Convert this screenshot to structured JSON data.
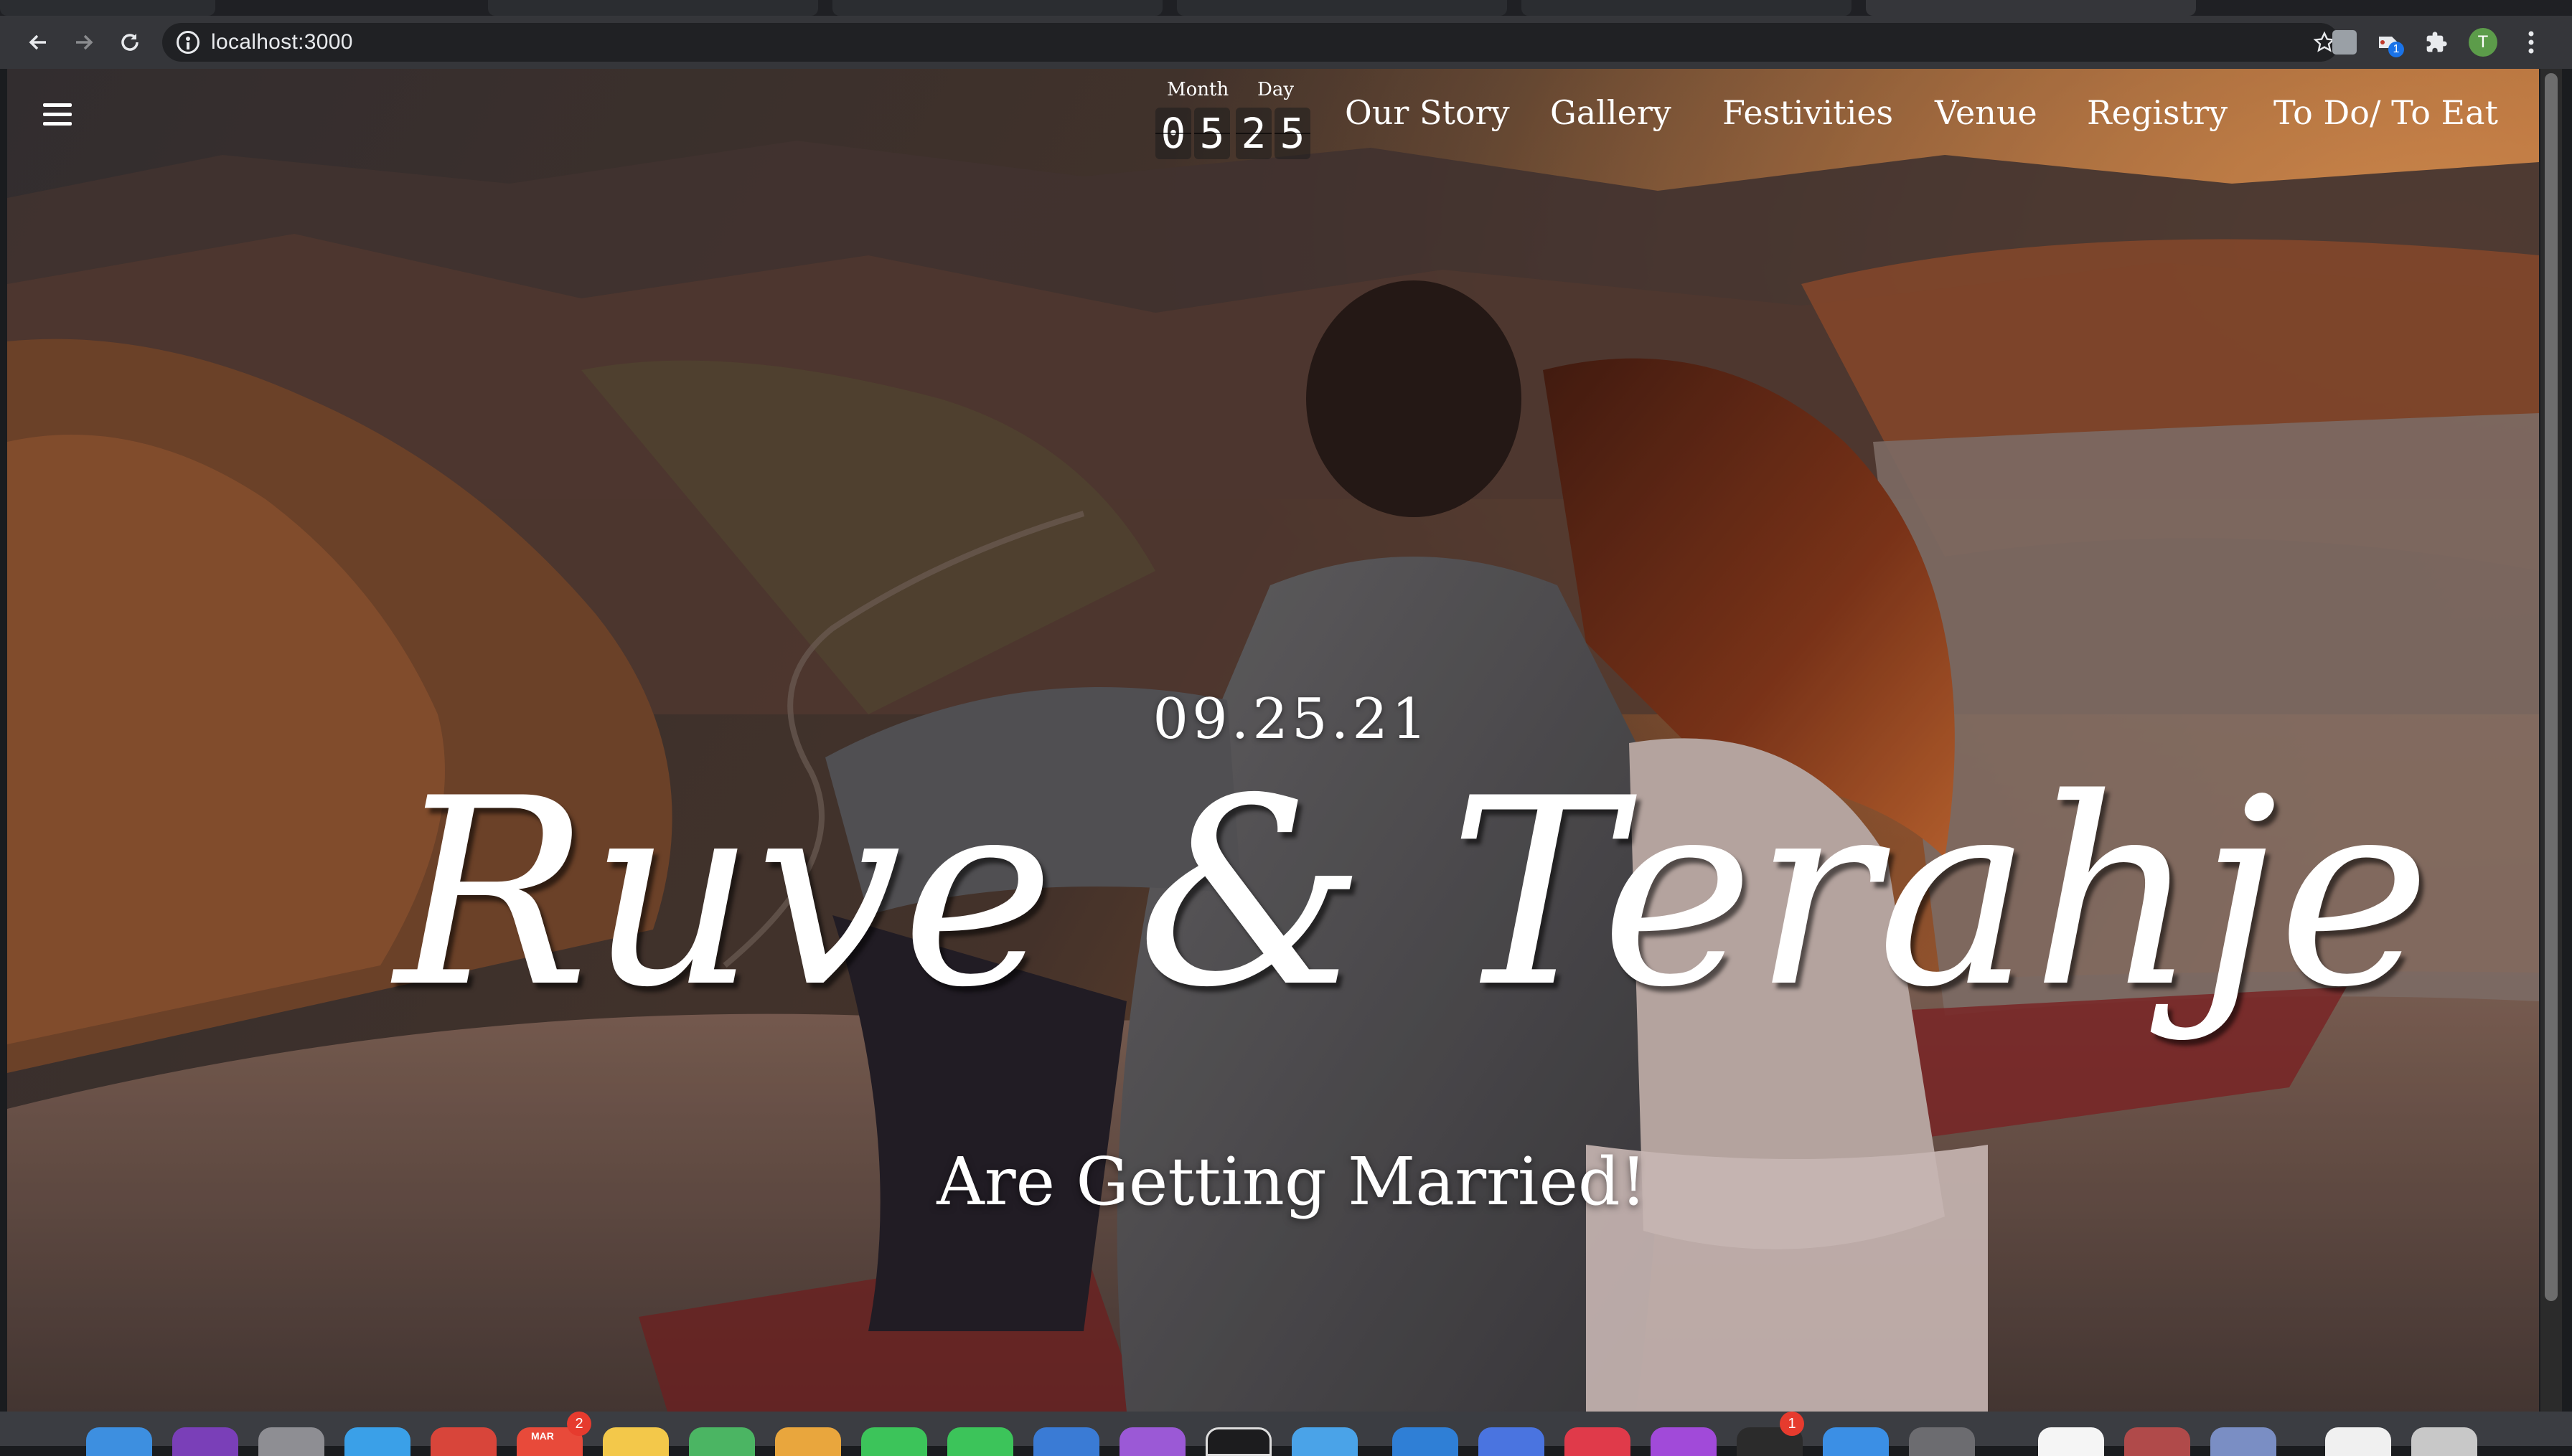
{
  "browser": {
    "url": "localhost:3000",
    "profile_initial": "T",
    "extension_badge": "1",
    "icons": {
      "back": "arrow-left-icon",
      "forward": "arrow-right-icon",
      "reload": "reload-icon",
      "info": "info-icon",
      "bookmark": "star-icon",
      "extensions": "puzzle-icon",
      "menu": "more-vertical-icon"
    }
  },
  "header": {
    "menu_icon": "hamburger-icon",
    "countdown": {
      "month_label": "Month",
      "day_label": "Day",
      "month_digits": [
        "0",
        "5"
      ],
      "day_digits": [
        "2",
        "5"
      ]
    },
    "nav": [
      {
        "label": "Our Story"
      },
      {
        "label": "Gallery"
      },
      {
        "label": "Festivities"
      },
      {
        "label": "Venue"
      },
      {
        "label": "Registry"
      },
      {
        "label": "To Do/ To Eat"
      }
    ]
  },
  "hero": {
    "date": "09.25.21",
    "names": "Ruve & Terahje",
    "tagline": "Are Getting Married!"
  },
  "dock": {
    "badges": [
      "2",
      "1"
    ],
    "calendar_month": "MAR"
  },
  "colors": {
    "chrome_toolbar": "#35363a",
    "omnibox": "#202124",
    "text_on_hero": "#ffffff",
    "avatar": "#5c9c4a"
  }
}
